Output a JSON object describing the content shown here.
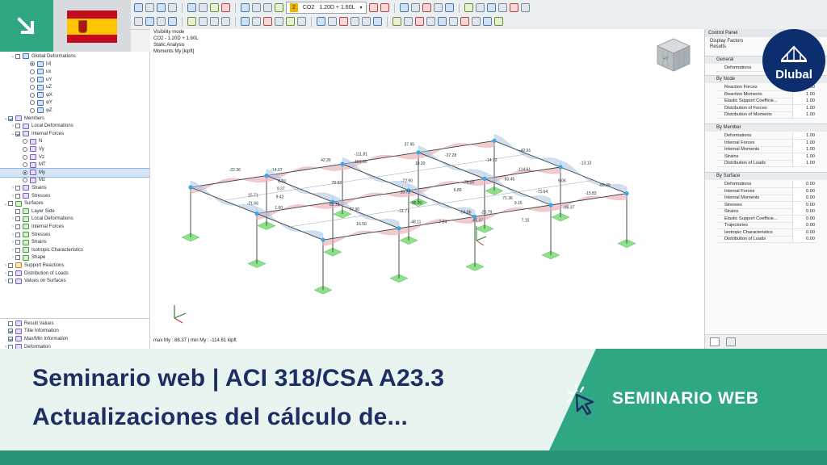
{
  "toolbar": {
    "load_case_tag": "CO2",
    "load_case_badge": "2",
    "load_case_formula": "1.20D + 1.60L"
  },
  "navigator": {
    "items": [
      {
        "indent": 1,
        "toggle": "⌄",
        "ctl": "cb",
        "on": false,
        "icon": "b",
        "label": "Global Deformations"
      },
      {
        "indent": 3,
        "toggle": "",
        "ctl": "rd",
        "on": true,
        "icon": "b",
        "label": "|u|"
      },
      {
        "indent": 3,
        "toggle": "",
        "ctl": "rd",
        "on": false,
        "icon": "b",
        "label": "ux"
      },
      {
        "indent": 3,
        "toggle": "",
        "ctl": "rd",
        "on": false,
        "icon": "b",
        "label": "uY"
      },
      {
        "indent": 3,
        "toggle": "",
        "ctl": "rd",
        "on": false,
        "icon": "b",
        "label": "uZ"
      },
      {
        "indent": 3,
        "toggle": "",
        "ctl": "rd",
        "on": false,
        "icon": "b",
        "label": "φX"
      },
      {
        "indent": 3,
        "toggle": "",
        "ctl": "rd",
        "on": false,
        "icon": "b",
        "label": "φY"
      },
      {
        "indent": 3,
        "toggle": "",
        "ctl": "rd",
        "on": false,
        "icon": "b",
        "label": "φZ"
      },
      {
        "indent": 0,
        "toggle": "⌄",
        "ctl": "cb",
        "on": true,
        "icon": "",
        "label": "Members"
      },
      {
        "indent": 1,
        "toggle": "›",
        "ctl": "cb",
        "on": false,
        "icon": "",
        "label": "Local Deformations"
      },
      {
        "indent": 1,
        "toggle": "⌄",
        "ctl": "cb",
        "on": true,
        "icon": "",
        "label": "Internal Forces"
      },
      {
        "indent": 2,
        "toggle": "",
        "ctl": "rd",
        "on": false,
        "icon": "",
        "label": "N"
      },
      {
        "indent": 2,
        "toggle": "",
        "ctl": "rd",
        "on": false,
        "icon": "",
        "label": "Vy"
      },
      {
        "indent": 2,
        "toggle": "",
        "ctl": "rd",
        "on": false,
        "icon": "",
        "label": "Vz"
      },
      {
        "indent": 2,
        "toggle": "",
        "ctl": "rd",
        "on": false,
        "icon": "",
        "label": "MT"
      },
      {
        "indent": 2,
        "toggle": "",
        "ctl": "rd",
        "on": true,
        "icon": "",
        "label": "My",
        "sel": true
      },
      {
        "indent": 2,
        "toggle": "",
        "ctl": "rd",
        "on": false,
        "icon": "",
        "label": "Mz"
      },
      {
        "indent": 1,
        "toggle": "›",
        "ctl": "cb",
        "on": false,
        "icon": "",
        "label": "Strains"
      },
      {
        "indent": 1,
        "toggle": "›",
        "ctl": "cb",
        "on": false,
        "icon": "",
        "label": "Stresses"
      },
      {
        "indent": 0,
        "toggle": "⌄",
        "ctl": "cb",
        "on": false,
        "icon": "g",
        "label": "Surfaces"
      },
      {
        "indent": 1,
        "toggle": "",
        "ctl": "cb",
        "on": false,
        "icon": "g",
        "label": "Layer Side"
      },
      {
        "indent": 1,
        "toggle": "›",
        "ctl": "cb",
        "on": false,
        "icon": "g",
        "label": "Local Deformations"
      },
      {
        "indent": 1,
        "toggle": "›",
        "ctl": "cb",
        "on": false,
        "icon": "g",
        "label": "Internal Forces"
      },
      {
        "indent": 1,
        "toggle": "›",
        "ctl": "cb",
        "on": false,
        "icon": "g",
        "label": "Stresses"
      },
      {
        "indent": 1,
        "toggle": "›",
        "ctl": "cb",
        "on": false,
        "icon": "g",
        "label": "Strains"
      },
      {
        "indent": 1,
        "toggle": "›",
        "ctl": "cb",
        "on": false,
        "icon": "g",
        "label": "Isotropic Characteristics"
      },
      {
        "indent": 1,
        "toggle": "›",
        "ctl": "cb",
        "on": false,
        "icon": "g",
        "label": "Shape"
      },
      {
        "indent": 0,
        "toggle": "›",
        "ctl": "cb",
        "on": false,
        "icon": "o",
        "label": "Support Reactions"
      },
      {
        "indent": 0,
        "toggle": "›",
        "ctl": "cb",
        "on": false,
        "icon": "",
        "label": "Distribution of Loads"
      },
      {
        "indent": 0,
        "toggle": "›",
        "ctl": "cb",
        "on": false,
        "icon": "",
        "label": "Values on Surfaces"
      }
    ],
    "bottom_items": [
      {
        "indent": 0,
        "toggle": "",
        "ctl": "cb",
        "on": false,
        "icon": "",
        "label": "Result Values"
      },
      {
        "indent": 0,
        "toggle": "",
        "ctl": "cb",
        "on": true,
        "icon": "",
        "label": "Title Information"
      },
      {
        "indent": 0,
        "toggle": "",
        "ctl": "cb",
        "on": true,
        "icon": "",
        "label": "Max/Min Information"
      },
      {
        "indent": 0,
        "toggle": "›",
        "ctl": "cb",
        "on": false,
        "icon": "",
        "label": "Deformation"
      }
    ]
  },
  "viewport": {
    "info_lines": [
      "Visibility mode",
      "CO2 - 1.20D + 1.60L",
      "Static Analysis",
      "Moments My [kipft]"
    ],
    "footer": "max My : 86.37 | min My : -114.61 kipft",
    "labels": [
      "-14.07",
      "42.35",
      "-22.36",
      "8.10",
      "-111.81",
      "37.95",
      "15.71",
      "9.37",
      "-101.00",
      "-37.28",
      "-21.66",
      "9.42",
      "78.93",
      "-72.90",
      "10.30",
      "-14.73",
      "-42.91",
      "1.60",
      "82.72",
      "33.73",
      "6.89",
      "83.45",
      "77.90",
      "-11.77",
      "86.80",
      "-76.00",
      "-114.61",
      "16.50",
      "-48.11",
      "-54.86",
      "9.06",
      "71.36",
      "-86.37",
      "7.15",
      "-73.64",
      "-15.83",
      "-86.99",
      "-20.79",
      "9.15",
      "7.24",
      "-13.13",
      "-86.37"
    ]
  },
  "control_panel": {
    "title": "Control Panel",
    "sub1": "Display Factors",
    "sub2": "Results",
    "sections": [
      {
        "name": "General",
        "rows": [
          {
            "label": "Deformations",
            "value": "1.00"
          }
        ]
      },
      {
        "name": "By Node",
        "rows": [
          {
            "label": "Reaction Forces",
            "value": "1.00"
          },
          {
            "label": "Reaction Moments",
            "value": "1.00"
          },
          {
            "label": "Elastic Support Coefficie...",
            "value": "1.00"
          },
          {
            "label": "Distribution of Forces",
            "value": "1.00"
          },
          {
            "label": "Distribution of Moments",
            "value": "1.00"
          }
        ]
      },
      {
        "name": "By Member",
        "rows": [
          {
            "label": "Deformations",
            "value": "1.00"
          },
          {
            "label": "Internal Forces",
            "value": "1.00"
          },
          {
            "label": "Internal Moments",
            "value": "1.00"
          },
          {
            "label": "Strains",
            "value": "1.00"
          },
          {
            "label": "Distribution of Loads",
            "value": "1.00"
          }
        ]
      },
      {
        "name": "By Surface",
        "rows": [
          {
            "label": "Deformations",
            "value": "0.00"
          },
          {
            "label": "Internal Forces",
            "value": "0.00"
          },
          {
            "label": "Internal Moments",
            "value": "0.00"
          },
          {
            "label": "Stresses",
            "value": "0.00"
          },
          {
            "label": "Strains",
            "value": "0.00"
          },
          {
            "label": "Elastic Support Coefficie...",
            "value": "0.00"
          },
          {
            "label": "Trajectories",
            "value": "0.00"
          },
          {
            "label": "Isotropic Characteristics",
            "value": "0.00"
          },
          {
            "label": "Distribution of Loads",
            "value": "0.00"
          }
        ]
      }
    ]
  },
  "logo": {
    "text": "Dlubal"
  },
  "banner": {
    "title_line1": "Seminario web | ACI 318/CSA A23.3",
    "title_line2": "Actualizaciones del cálculo de...",
    "badge": "SEMINARIO WEB"
  },
  "colors": {
    "brand_green": "#2fa784",
    "navy": "#1d2e63",
    "moment_pos": "#e8a0a8",
    "moment_neg": "#a9c4e4",
    "support": "#8fe08a"
  }
}
